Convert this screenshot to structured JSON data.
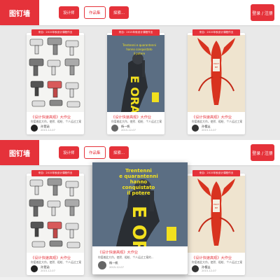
{
  "header": {
    "logo": "图钉墙",
    "nav": [
      "设计师",
      "作品集",
      "探索..."
    ],
    "login": "登录 / 注册"
  },
  "cards": [
    {
      "tag": "来自：2015年秋设计课程作业",
      "title": "《设计快速高观》大作业",
      "desc": "你爱着此大作，使然、粗绘、个人运过工案的...",
      "user": "孙楚涵",
      "date": "2015-12-07",
      "art": "drill-sketches"
    },
    {
      "tag": "来自：2015年秋设计课程作业",
      "title": "《设计快速高观》大作业",
      "desc": "你爱着此大作，使然、粗绘、个人运过工案的...",
      "user": "杨一帆",
      "date": "2015-12-07",
      "art": "e-ora-poster",
      "poster_text": "Trentenni e quarantenni hanno conquistato il potere",
      "poster_big": "E ORA?"
    },
    {
      "tag": "来自：2015年秋设计课程作业",
      "title": "《设计快速高观》大作业",
      "desc": "你爱着此大作，使然、粗绘、个人运过工案的...",
      "user": "孙樱丛",
      "date": "2015-12-07",
      "art": "lobster-poster",
      "poster_text": "PROTECT ME"
    }
  ],
  "colors": {
    "accent": "#e5323a",
    "poster_blue": "#5b6e83",
    "poster_yellow": "#f2e01e",
    "lobster": "#d8331f"
  }
}
